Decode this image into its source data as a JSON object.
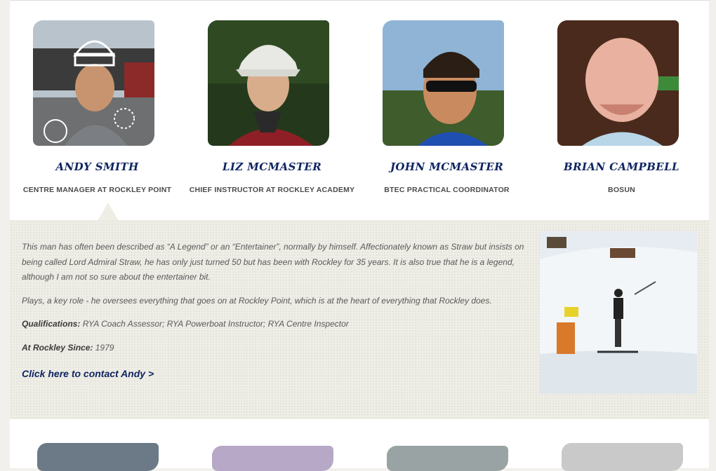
{
  "staff": [
    {
      "name": "Andy Smith",
      "role": "CENTRE MANAGER AT ROCKLEY POINT",
      "photo": "andy-smith-photo"
    },
    {
      "name": "Liz McMaster",
      "role": "CHIEF INSTRUCTOR AT ROCKLEY ACADEMY",
      "photo": "liz-mcmaster-photo"
    },
    {
      "name": "John McMaster",
      "role": "BTEC PRACTICAL COORDINATOR",
      "photo": "john-mcmaster-photo"
    },
    {
      "name": "Brian Campbell",
      "role": "BOSUN",
      "photo": "brian-campbell-photo"
    }
  ],
  "detail": {
    "bio": "This man has often been described as “A Legend” or an “Entertainer”, normally by himself. Affectionately known as Straw but insists on being called Lord Admiral Straw, he has only just turned 50 but has been with Rockley for 35 years. It is also true that he is a legend, although I am not so sure about the entertainer bit.",
    "role_text": "Plays, a key role - he oversees everything that goes on at Rockley Point, which is at the heart of everything that Rockley does.",
    "qualifications_label": "Qualifications:",
    "qualifications": "RYA Coach Assessor; RYA Powerboat Instructor; RYA Centre Inspector",
    "since_label": "At Rockley Since:",
    "since": "1979",
    "contact_link": "Click here to contact Andy >",
    "photo": "skier-snow-photo"
  },
  "colors": {
    "name": "#0f2561",
    "detail_bg": "#eeede6",
    "page_bg": "#f1f0ec"
  }
}
